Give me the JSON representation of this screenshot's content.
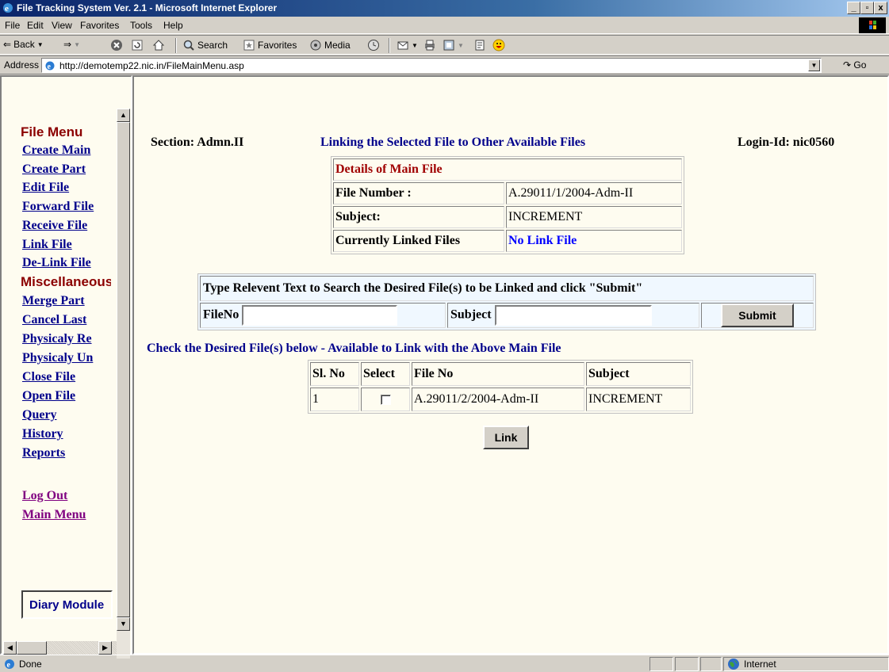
{
  "window": {
    "title": "File Tracking System Ver. 2.1 - Microsoft Internet Explorer",
    "controls": [
      "_",
      "Η",
      "x"
    ]
  },
  "menubar": [
    "File",
    "Edit",
    "View",
    "Favorites",
    "Tools",
    "Help"
  ],
  "toolbar": {
    "back": "Back",
    "search": "Search",
    "favorites": "Favorites",
    "media": "Media"
  },
  "address": {
    "label": "Address",
    "url": "http://demotemp22.nic.in/FileMainMenu.asp",
    "go": "Go"
  },
  "nav": {
    "file_menu": "File Menu",
    "links1": [
      "Create Main",
      "Create Part",
      "Edit File",
      "Forward File",
      "Receive File",
      "Link File",
      "De-Link File"
    ],
    "misc": "Miscellaneous",
    "links2": [
      "Merge Part",
      "Cancel Last",
      "Physicaly Re",
      "Physicaly Un",
      "Close File",
      "Open File",
      "Query",
      "History",
      "Reports"
    ],
    "logout": "Log Out",
    "main_menu": "Main Menu",
    "diary": "Diary Module"
  },
  "page": {
    "section": "Section: Admn.II",
    "heading": "Linking the Selected File to Other Available Files",
    "login": "Login-Id: nic0560",
    "main_file": {
      "title": "Details of Main File",
      "file_number_label": "File Number :",
      "file_number": "A.29011/1/2004-Adm-II",
      "subject_label": "Subject:",
      "subject": "INCREMENT",
      "linked_label": "Currently Linked Files",
      "linked_value": "No Link File"
    },
    "search": {
      "instruction": "Type Relevent Text to Search the Desired File(s) to be Linked and click \"Submit\"",
      "fileno_label": "FileNo",
      "subject_label": "Subject",
      "fileno_value": "",
      "subject_value": "",
      "submit": "Submit"
    },
    "check_heading": "Check the Desired File(s) below - Available to Link with the Above Main File",
    "available": {
      "headers": [
        "Sl. No",
        "Select",
        "File No",
        "Subject"
      ],
      "rows": [
        {
          "sl": "1",
          "checked": false,
          "file_no": "A.29011/2/2004-Adm-II",
          "subject": "INCREMENT"
        }
      ]
    },
    "link_button": "Link"
  },
  "status": {
    "text": "Done",
    "zone": "Internet"
  }
}
